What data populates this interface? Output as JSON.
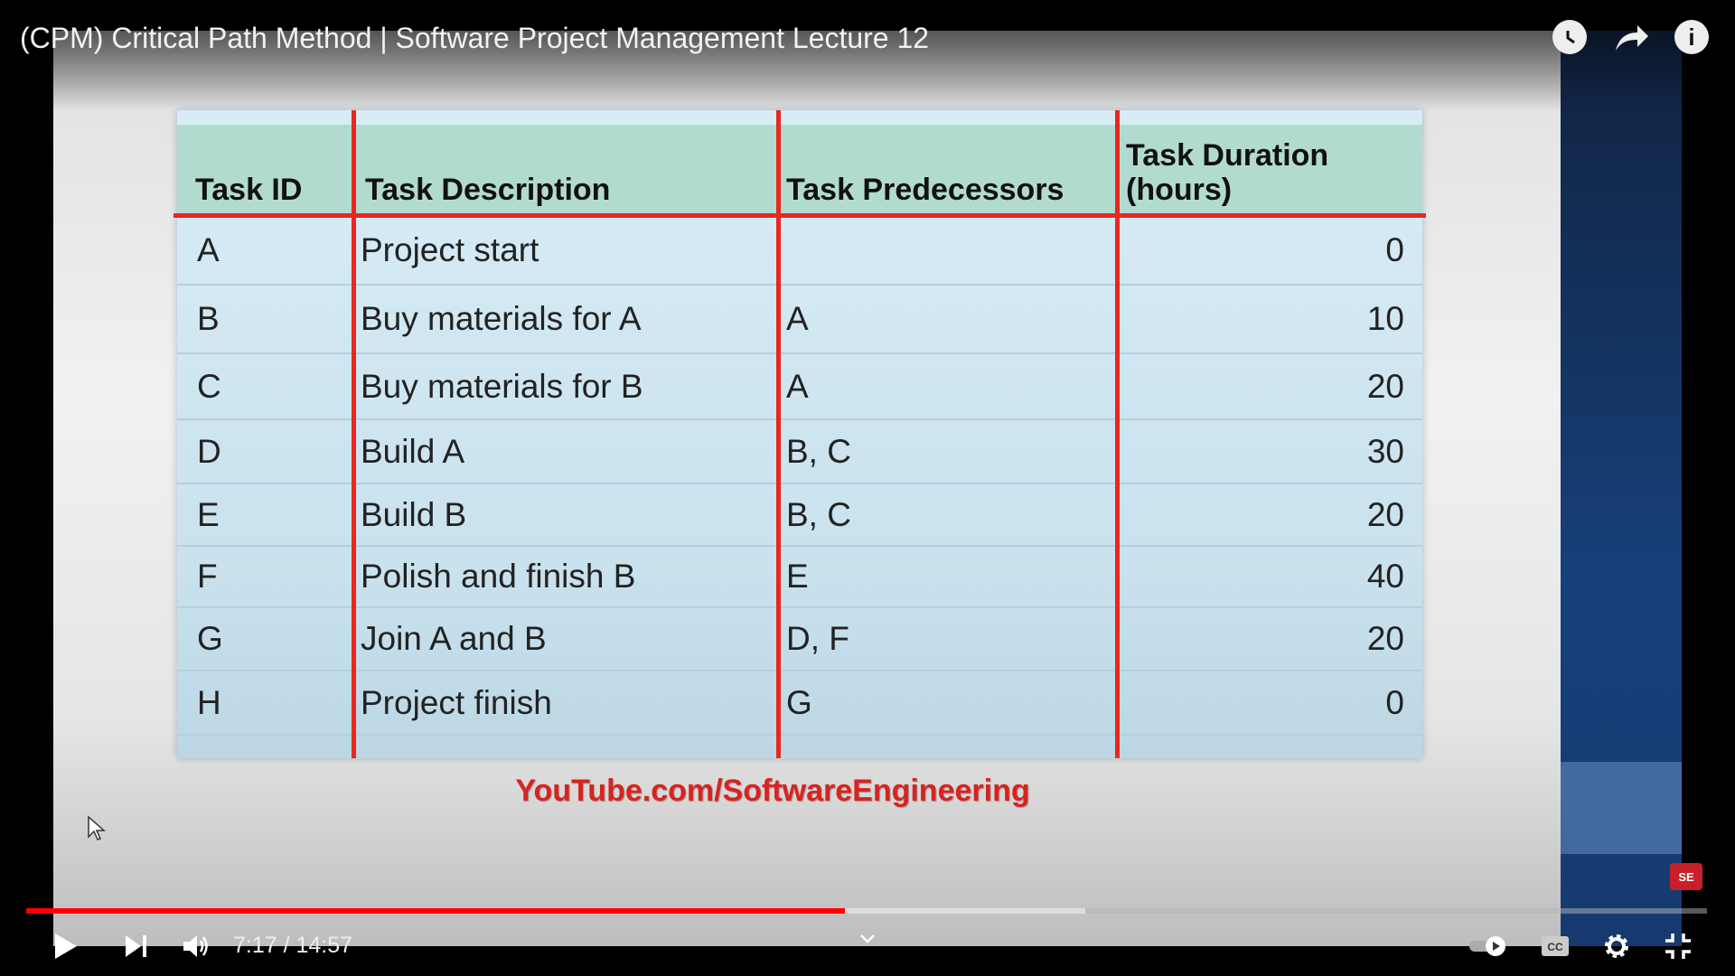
{
  "video": {
    "title": "(CPM) Critical Path Method | Software Project Management Lecture 12",
    "current_time": "7:17",
    "duration": "14:57",
    "time_display": "7:17 / 14:57",
    "progress_fraction": 0.487,
    "buffered_fraction": 0.63
  },
  "slide": {
    "headers": [
      "Task ID",
      "Task Description",
      "Task Predecessors",
      "Task Duration (hours)"
    ],
    "rows": [
      [
        "A",
        "Project start",
        "",
        "0"
      ],
      [
        "B",
        "Buy materials for A",
        "A",
        "10"
      ],
      [
        "C",
        "Buy materials for B",
        "A",
        "20"
      ],
      [
        "D",
        "Build A",
        "B, C",
        "30"
      ],
      [
        "E",
        "Build B",
        "B, C",
        "20"
      ],
      [
        "F",
        "Polish and finish B",
        "E",
        "40"
      ],
      [
        "G",
        "Join A and B",
        "D, F",
        "20"
      ],
      [
        "H",
        "Project finish",
        "G",
        "0"
      ]
    ],
    "watermark": "YouTube.com/SoftwareEngineering",
    "logo": "SE"
  },
  "colors": {
    "accent": "#ff0000",
    "grid_red": "#e8271f",
    "header_bg": "#b2dbd0",
    "row_bg": "#d8ecf6"
  },
  "icons": [
    "clock-icon",
    "share-icon",
    "info-icon",
    "play-icon",
    "next-icon",
    "volume-icon",
    "chevron-down-icon",
    "autoplay-toggle",
    "captions-icon",
    "settings-icon",
    "exit-fullscreen-icon"
  ]
}
